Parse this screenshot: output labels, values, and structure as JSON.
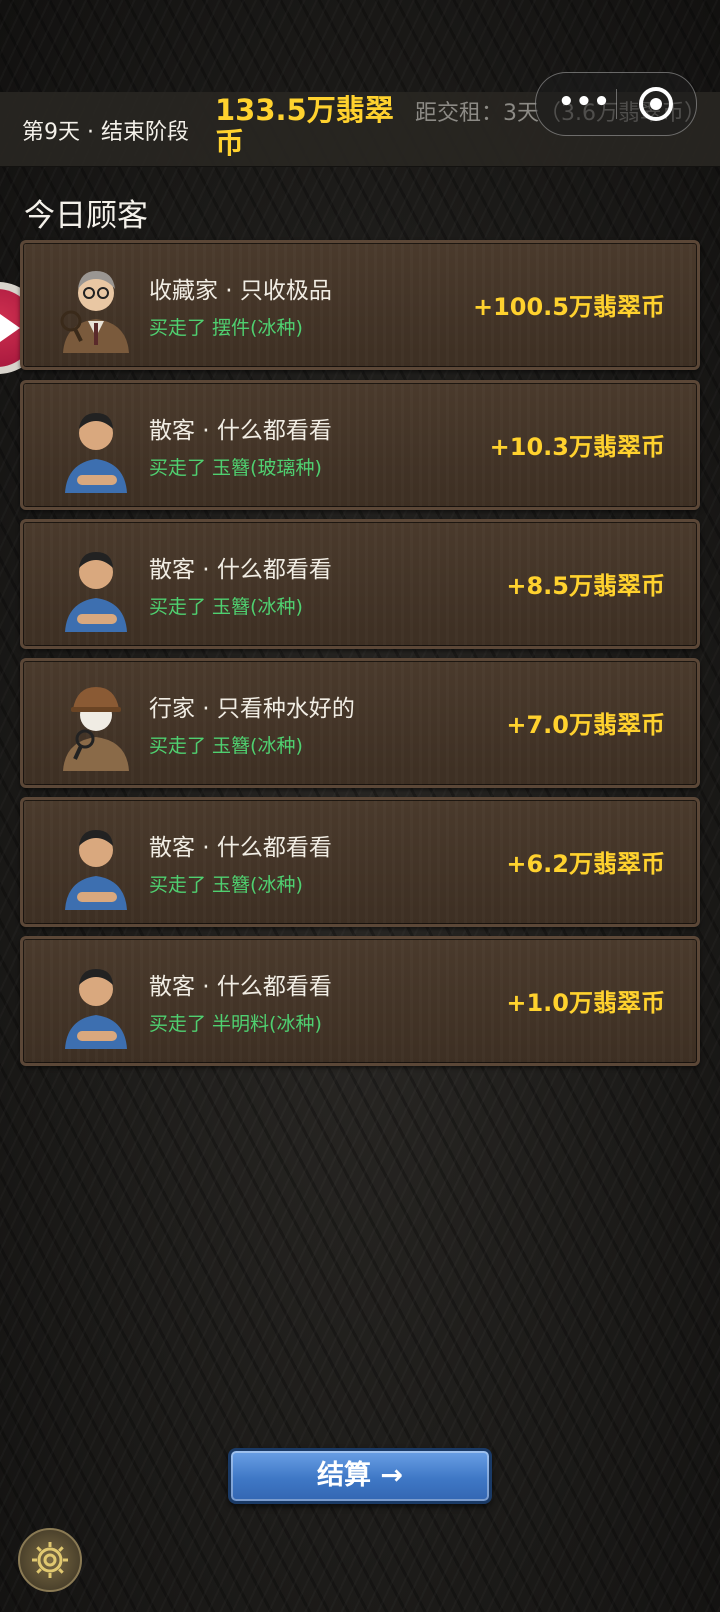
{
  "header": {
    "day_stage": "第9天 · 结束阶段",
    "money": "133.5万翡翠币",
    "rent": "距交租：3天（3.6万翡翠币）"
  },
  "section_title": "今日顾客",
  "customers": [
    {
      "name": "收藏家 · 只收极品",
      "bought": "买走了  摆件(冰种)",
      "amount": "+100.5万翡翠币",
      "avatar": "collector-avatar"
    },
    {
      "name": "散客 · 什么都看看",
      "bought": "买走了  玉簪(玻璃种)",
      "amount": "+10.3万翡翠币",
      "avatar": "casual-customer-avatar"
    },
    {
      "name": "散客 · 什么都看看",
      "bought": "买走了  玉簪(冰种)",
      "amount": "+8.5万翡翠币",
      "avatar": "casual-customer-avatar"
    },
    {
      "name": "行家 · 只看种水好的",
      "bought": "买走了  玉簪(冰种)",
      "amount": "+7.0万翡翠币",
      "avatar": "expert-avatar"
    },
    {
      "name": "散客 · 什么都看看",
      "bought": "买走了  玉簪(冰种)",
      "amount": "+6.2万翡翠币",
      "avatar": "casual-customer-avatar"
    },
    {
      "name": "散客 · 什么都看看",
      "bought": "买走了  半明料(冰种)",
      "amount": "+1.0万翡翠币",
      "avatar": "casual-customer-avatar"
    }
  ],
  "settle_button": "结算 →",
  "icons": {
    "menu": "more-dots-icon",
    "close": "target-icon",
    "side": "play-icon",
    "settings": "gear-icon"
  },
  "colors": {
    "money": "#ffd22e",
    "bought": "#4fd070",
    "button": "#4a82d2"
  }
}
